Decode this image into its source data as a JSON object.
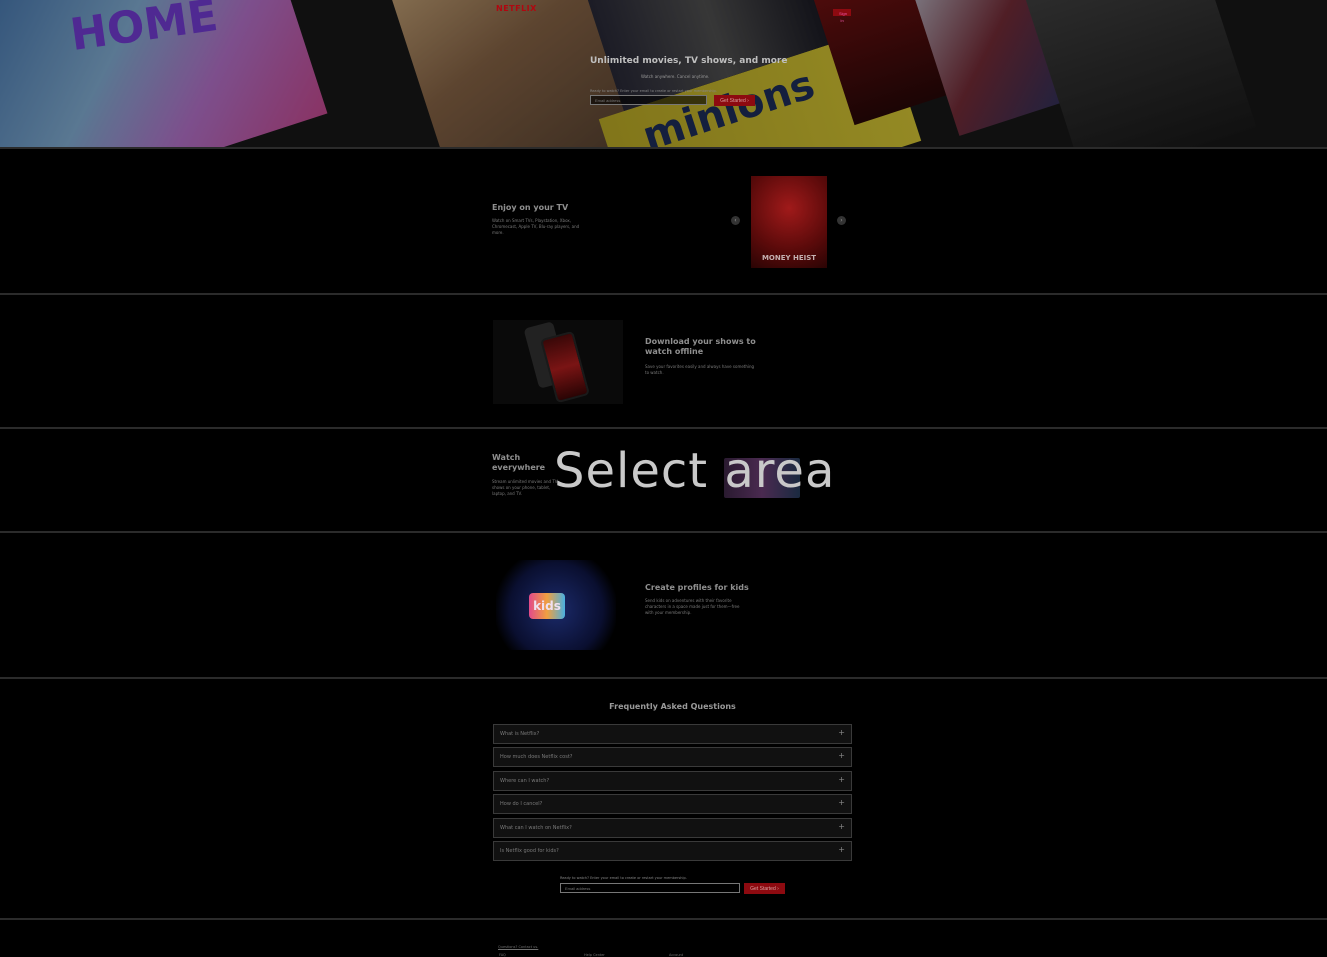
{
  "header": {
    "logo": "NETFLIX",
    "signin_label": "Sign In"
  },
  "hero": {
    "title": "Unlimited movies, TV shows, and more",
    "subtitle": "Watch anywhere. Cancel anytime.",
    "cta_text": "Ready to watch? Enter your email to create or restart your membership.",
    "email_placeholder": "Email address",
    "get_started_label": "Get Started",
    "poster_titles": [
      "HOME",
      "minions"
    ]
  },
  "features": [
    {
      "title": "Enjoy on your TV",
      "text": "Watch on Smart TVs, Playstation, Xbox, Chromecast, Apple TV, Blu-ray players, and more.",
      "poster_title": "MONEY HEIST"
    },
    {
      "title": "Download your shows to watch offline",
      "text": "Save your favorites easily and always have something to watch."
    },
    {
      "title": "Watch everywhere",
      "text": "Stream unlimited movies and TV shows on your phone, tablet, laptop, and TV."
    },
    {
      "title": "Create profiles for kids",
      "text": "Send kids on adventures with their favorite characters in a space made just for them—free with your membership.",
      "badge": "kids"
    }
  ],
  "overlay_text": "Select area",
  "faq": {
    "title": "Frequently Asked Questions",
    "items": [
      "What is Netflix?",
      "How much does Netflix cost?",
      "Where can I watch?",
      "How do I cancel?",
      "What can I watch on Netflix?",
      "Is Netflix good for kids?"
    ],
    "cta_text": "Ready to watch? Enter your email to create or restart your membership.",
    "email_placeholder": "Email address",
    "get_started_label": "Get Started"
  },
  "footer": {
    "contact": "Questions? Contact us.",
    "links": [
      "FAQ",
      "Help Center",
      "Account"
    ]
  }
}
